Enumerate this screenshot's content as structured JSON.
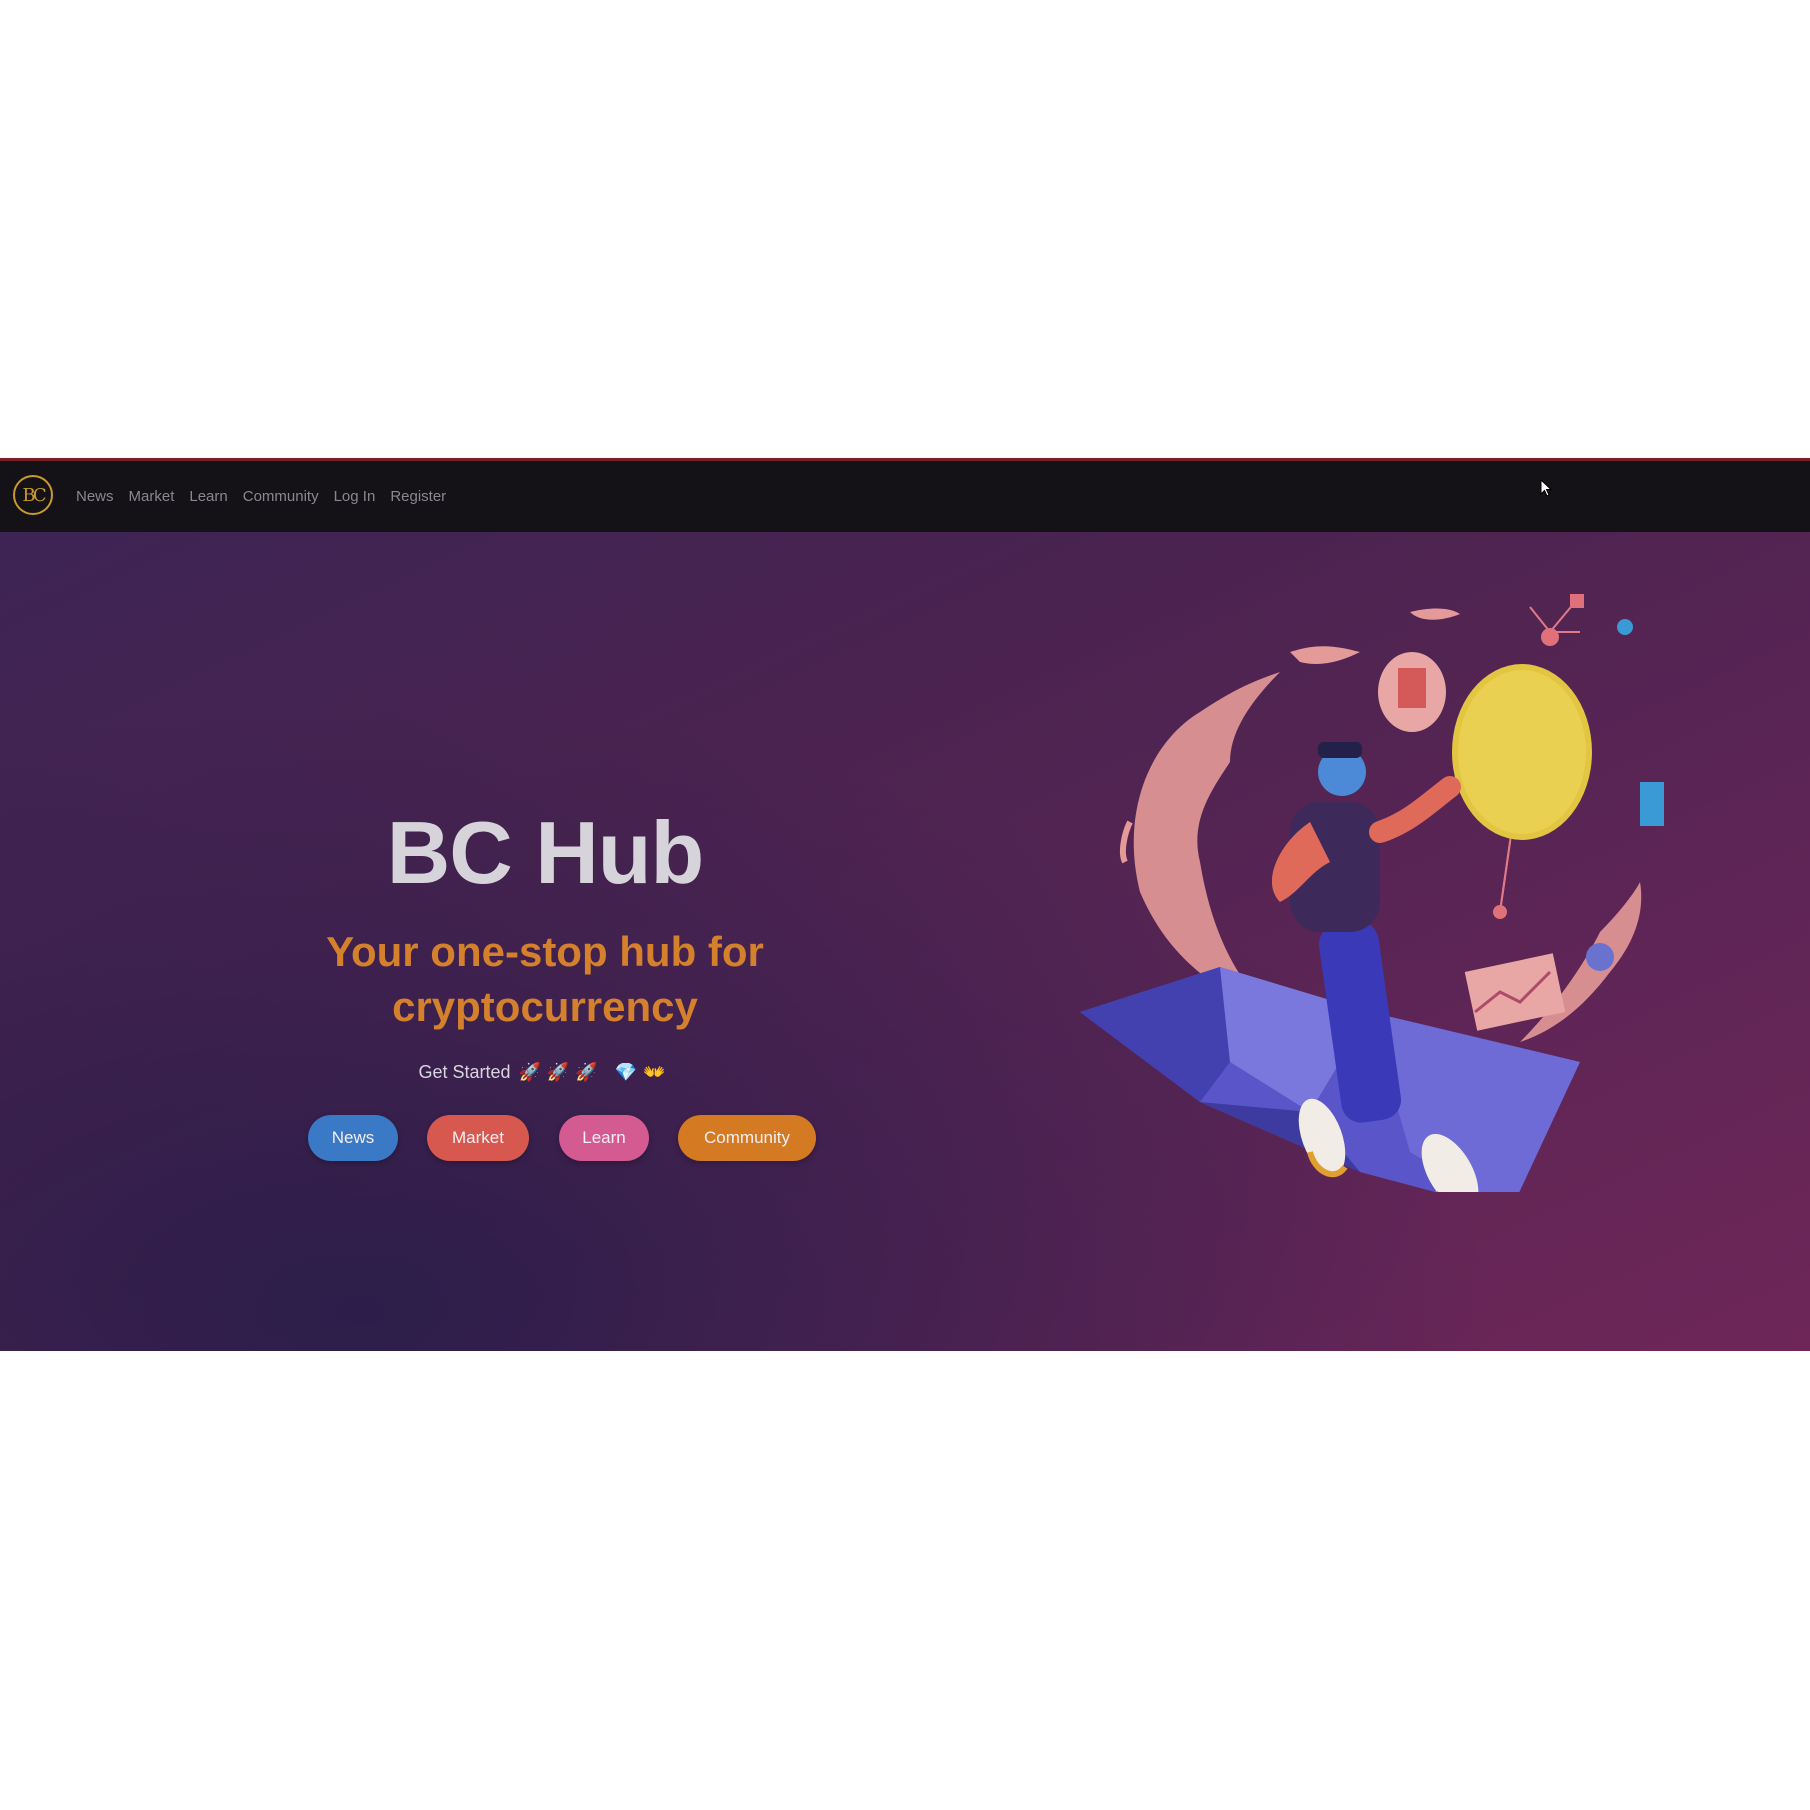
{
  "navbar": {
    "logo_text": "BC",
    "links": [
      "News",
      "Market",
      "Learn",
      "Community",
      "Log In",
      "Register"
    ]
  },
  "hero": {
    "title": "BC Hub",
    "subtitle_line1": "Your one-stop hub for",
    "subtitle_line2": "cryptocurrency",
    "get_started": "Get Started",
    "emojis": "🚀🚀🚀 💎👐",
    "buttons": {
      "news": "News",
      "market": "Market",
      "learn": "Learn",
      "community": "Community"
    }
  },
  "colors": {
    "navbar_bg": "#141216",
    "title": "#d6d4da",
    "subtitle": "#d4802c",
    "news_button": "#3a79c6",
    "market_button": "#d6584e",
    "learn_button": "#d45a92",
    "community_button": "#d47a22"
  }
}
